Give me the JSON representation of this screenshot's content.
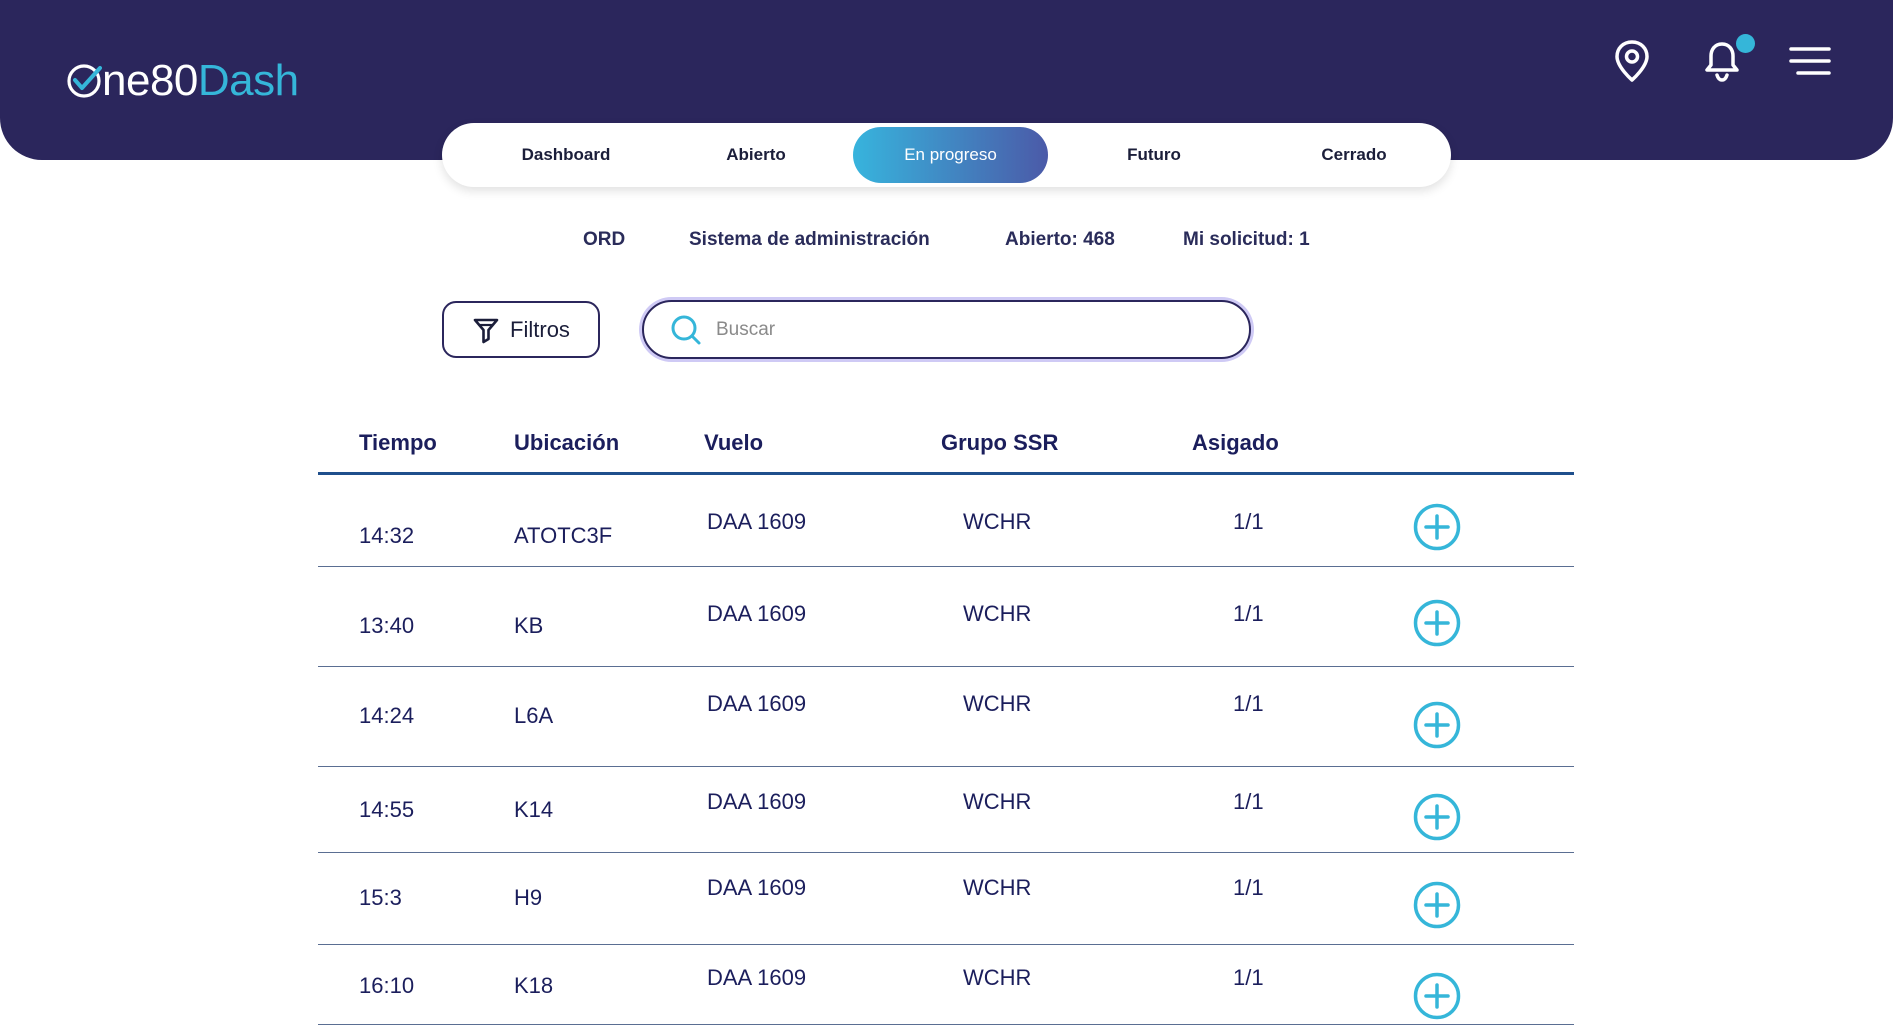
{
  "header": {
    "logo": {
      "part1": "ne80",
      "part2": "Dash"
    }
  },
  "tabs": [
    {
      "label": "Dashboard",
      "active": false
    },
    {
      "label": "Abierto",
      "active": false
    },
    {
      "label": "En progreso",
      "active": true
    },
    {
      "label": "Futuro",
      "active": false
    },
    {
      "label": "Cerrado",
      "active": false
    }
  ],
  "summary": {
    "station": "ORD",
    "system": "Sistema de administración",
    "open": "Abierto: 468",
    "my_requests": "Mi solicitud: 1"
  },
  "toolbar": {
    "filters_label": "Filtros",
    "search_placeholder": "Buscar"
  },
  "table": {
    "columns": [
      "Tiempo",
      "Ubicación",
      "Vuelo",
      "Grupo SSR",
      "Asigado"
    ],
    "rows": [
      {
        "time": "14:32",
        "location": "ATOTC3F",
        "flight": "DAA 1609",
        "ssr": "WCHR",
        "assigned": "1/1"
      },
      {
        "time": "13:40",
        "location": "KB",
        "flight": "DAA 1609",
        "ssr": "WCHR",
        "assigned": "1/1"
      },
      {
        "time": "14:24",
        "location": "L6A",
        "flight": "DAA 1609",
        "ssr": "WCHR",
        "assigned": "1/1"
      },
      {
        "time": "14:55",
        "location": "K14",
        "flight": "DAA 1609",
        "ssr": "WCHR",
        "assigned": "1/1"
      },
      {
        "time": "15:3",
        "location": "H9",
        "flight": "DAA 1609",
        "ssr": "WCHR",
        "assigned": "1/1"
      },
      {
        "time": "16:10",
        "location": "K18",
        "flight": "DAA 1609",
        "ssr": "WCHR",
        "assigned": "1/1"
      }
    ]
  },
  "icons": {
    "location": "map-pin-icon",
    "notifications": "bell-icon",
    "menu": "hamburger-menu-icon",
    "filters": "funnel-icon",
    "search": "search-icon",
    "add": "plus-circle-icon"
  },
  "colors": {
    "header_bg": "#2b265c",
    "accent": "#35b6d9",
    "text": "#1b1e5c"
  }
}
